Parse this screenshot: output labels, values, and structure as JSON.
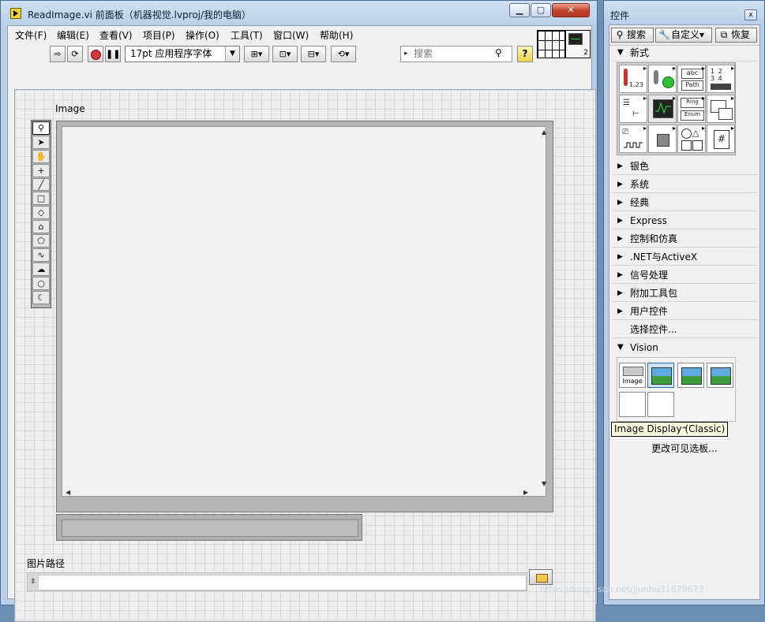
{
  "window": {
    "title": "ReadImage.vi 前面板（机器视觉.lvproj/我的电脑）",
    "min_label": "▁",
    "max_label": "▢",
    "close_label": "✕"
  },
  "menubar": [
    {
      "label": "文件(F)"
    },
    {
      "label": "编辑(E)"
    },
    {
      "label": "查看(V)"
    },
    {
      "label": "项目(P)"
    },
    {
      "label": "操作(O)"
    },
    {
      "label": "工具(T)"
    },
    {
      "label": "窗口(W)"
    },
    {
      "label": "帮助(H)"
    }
  ],
  "toolbar": {
    "font_label": "17pt 应用程序字体",
    "search_placeholder": "搜索",
    "help_label": "?",
    "connector_number": "2"
  },
  "front_panel": {
    "image_label": "Image",
    "path_label": "图片路径",
    "path_value": ""
  },
  "palette": {
    "title": "控件",
    "close_label": "x",
    "search_label": "搜索",
    "customize_label": "自定义▾",
    "restore_label": "恢复",
    "new_label": "新式",
    "categories": [
      {
        "label": "银色"
      },
      {
        "label": "系统"
      },
      {
        "label": "经典"
      },
      {
        "label": "Express"
      },
      {
        "label": "控制和仿真"
      },
      {
        "label": ".NET与ActiveX"
      },
      {
        "label": "信号处理"
      },
      {
        "label": "附加工具包"
      },
      {
        "label": "用户控件"
      },
      {
        "label": "选择控件..."
      }
    ],
    "vision_label": "Vision",
    "vision_image_item": "Image",
    "tooltip": "Image Display (Classic)",
    "more_visible_label": "更改可见选板...",
    "new_grid_labels": {
      "numeric": "1.23",
      "string_abc": "abc",
      "string_path": "Path",
      "ring": "Ring",
      "enum": "Enum",
      "array_1": "1 2",
      "array_2": "3 4",
      "hash": "#"
    }
  },
  "watermark": "https://blog.csdn.net/jjunhu31679673"
}
